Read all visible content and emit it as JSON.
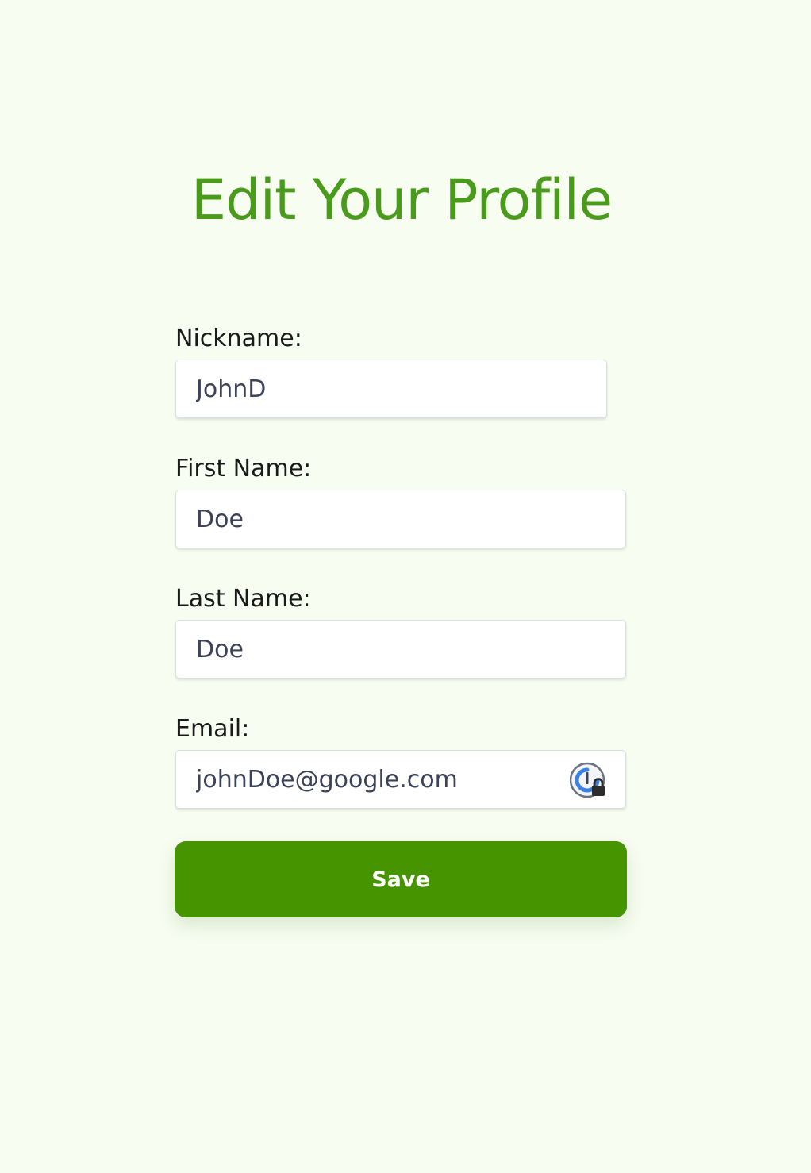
{
  "page": {
    "title": "Edit Your Profile"
  },
  "form": {
    "nickname": {
      "label": "Nickname:",
      "value": "JohnD"
    },
    "first_name": {
      "label": "First Name:",
      "value": "Doe"
    },
    "last_name": {
      "label": "Last Name:",
      "value": "Doe"
    },
    "email": {
      "label": "Email:",
      "value": "johnDoe@google.com",
      "icon": "password-manager-icon"
    },
    "save_label": "Save"
  },
  "colors": {
    "background": "#f7fdf1",
    "title": "#4a9a1c",
    "button": "#469400",
    "button_text": "#ffffff",
    "input_text": "#3c4257",
    "label_text": "#1a1a1a",
    "icon_blue": "#3b82e6"
  }
}
